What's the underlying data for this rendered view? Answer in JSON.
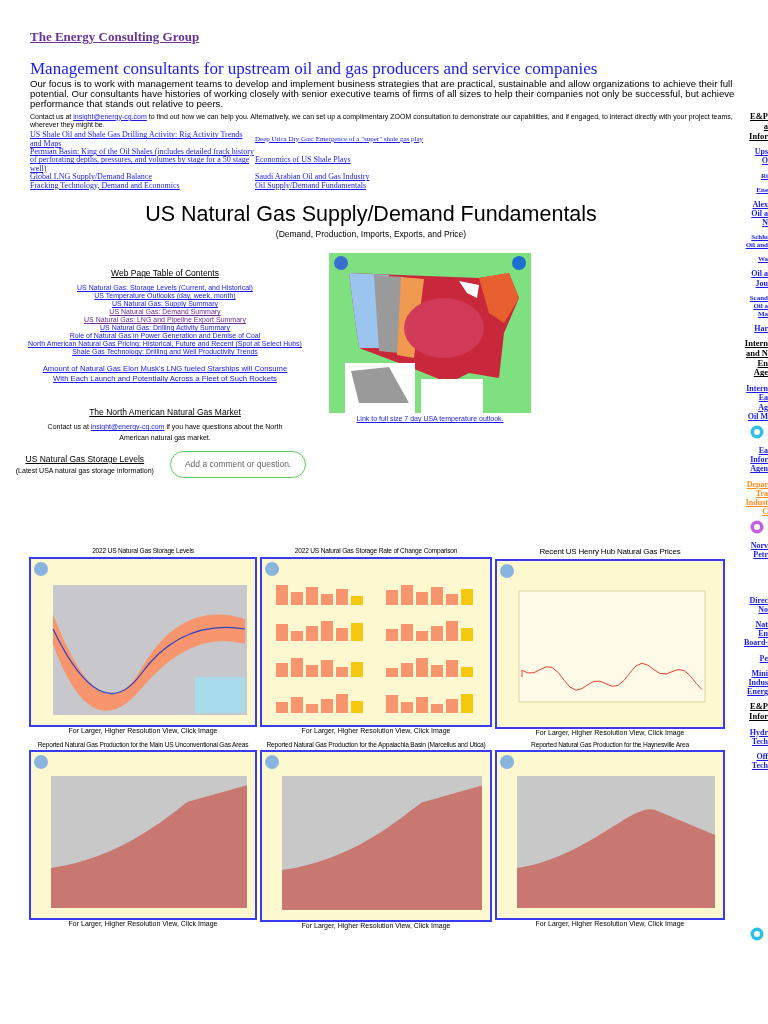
{
  "site_title": "The Energy Consulting Group",
  "tagline": "Management consultants for upstream oil and gas producers and service companies",
  "intro": "Our focus is to work with management teams to develop and implement business strategies that are practical, sustainable and allow organizations to achieve their full potential. Our consultants have histories of working closely with senior executive teams of firms of all sizes to help their companies not only be successful, but achieve performance that stands out relative to peers.",
  "contact": {
    "before": "Contact us at ",
    "link": "insight@energy-cg.com",
    "after": " to find out how we can help you.  Alternatively, we can set up a complimentary ZOOM consultation to demonstrate our capabilities, and if engaged, to interact directly with your project teams, wherever they might be."
  },
  "links_left": [
    "US Shale Oil and Shale Gas Drilling Activity: Rig Activity Trends and Maps",
    "Permian Basin:  King of the Oil Shales (includes detailed frack history of perforating depths, pressures, and volumes by stage for a 50 stage well)",
    "Global LNG Supply/Demand Balance",
    "Fracking Technology, Demand and Economics"
  ],
  "links_right": [
    {
      "text": "Deep Utica Dry Gas:  Emergence of a \"super\" shale gas play",
      "kind": "small"
    },
    {
      "text": "Economics of US Shale Plays",
      "kind": "normal"
    },
    {
      "text": "Saudi Arabian Oil and Gas Industry",
      "kind": "normal"
    },
    {
      "text": "Oil Supply/Demand Fundamentals",
      "kind": "normal"
    }
  ],
  "page_title": "US Natural Gas Supply/Demand Fundamentals",
  "page_subtitle": "(Demand, Production, Imports, Exports, and Price)",
  "toc": {
    "title": "Web Page Table of Contents",
    "items": [
      {
        "text": "US Natural Gas: Storage Levels (Current, and Historical)",
        "visited": false
      },
      {
        "text": "US Temperature Outlooks (day, week, month)",
        "visited": false
      },
      {
        "text": "US Natural Gas: Supply Summary",
        "visited": false
      },
      {
        "text": "US Natural Gas: Demand Summary",
        "visited": true
      },
      {
        "text": "US Natural Gas: LNG and Pipeline Export Summary",
        "visited": true
      },
      {
        "text": "US Natural Gas: Drilling Activity Summary",
        "visited": false
      },
      {
        "text": "Role of Natural Gas in Power Generation and Demise of Coal",
        "visited": false
      },
      {
        "text": "North American Natural Gas Pricing: Historical, Future and Recent (Spot at Select Hubs)",
        "visited": false
      },
      {
        "text": "Shale Gas Technology:  Drilling and Well Productivity Trends",
        "visited": false
      }
    ]
  },
  "feature_link": "Amount of Natural Gas Elon Musk's LNG fueled Starships will Consume With Each Launch and Potentially Across a Fleet of Such Rockets",
  "map": {
    "kind": "picture",
    "caption": "Link to full size 7 day USA temperature outlook."
  },
  "market": {
    "title": "The North American Natural Gas Market",
    "before": "Contact us at ",
    "link": "insight@energy-cg.com",
    "after": " if you have questions about the North American natural gas market."
  },
  "storage": {
    "title": "US Natural Gas Storage Levels",
    "subtitle": "(Latest USA natural gas storage information)"
  },
  "comment_button": "Add a comment or question.",
  "charts": [
    {
      "title": "2022 US Natural Gas Storage Levels",
      "caption": "For Larger, Higher Resolution View, Click Image"
    },
    {
      "title": "2022 US Natural Gas Storage Rate of Change Comparison",
      "caption": "For Larger, Higher Resolution View, Click Image"
    },
    {
      "title": "Recent US Henry Hub Natural Gas Prices",
      "caption": "For Larger, Higher Resolution View, Click Image"
    },
    {
      "title": "Reported Natural Gas Production for the Main US Unconventional Gas Areas",
      "caption": "For Larger, Higher Resolution View, Click Image"
    },
    {
      "title": "Reported Natural Gas Production for the Appalachia Basin (Marcellus and Utica)",
      "caption": "For Larger, Higher Resolution View, Click Image"
    },
    {
      "title": "Reported Natural Gas Production for the Haynesville Area",
      "caption": "For Larger, Higher Resolution View, Click Image"
    }
  ],
  "sidebar_top": [
    {
      "lines": [
        "E&P",
        "a",
        "Infor"
      ],
      "kind": "heading"
    },
    {
      "lines": [
        "Ups",
        "O"
      ],
      "kind": "link"
    },
    {
      "lines": [
        "Ri"
      ],
      "kind": "small"
    },
    {
      "lines": [
        "Ene"
      ],
      "kind": "small"
    },
    {
      "lines": [
        "Alex",
        "Oil a",
        "N"
      ],
      "kind": "link"
    },
    {
      "lines": [
        "Schlu",
        "Oil and"
      ],
      "kind": "small"
    },
    {
      "lines": [
        "Wa"
      ],
      "kind": "small"
    },
    {
      "lines": [
        "Oil a",
        "Jou"
      ],
      "kind": "link"
    },
    {
      "lines": [
        "Scand",
        "Oil a",
        "Ma"
      ],
      "kind": "small"
    },
    {
      "lines": [
        "Har"
      ],
      "kind": "link"
    },
    {
      "lines": [
        "Intern",
        "and N",
        "En",
        "Age"
      ],
      "kind": "heading"
    },
    {
      "lines": [
        "Intern",
        "Ea",
        "Ag",
        "Oil M"
      ],
      "kind": "link"
    },
    {
      "lines": [
        "Ea",
        "Infor",
        "Agen"
      ],
      "kind": "link"
    },
    {
      "lines": [
        "Depar",
        "Tra",
        "Indust",
        "C"
      ],
      "kind": "highlight"
    },
    {
      "lines": [
        "Norv",
        "Petr"
      ],
      "kind": "link"
    }
  ],
  "sidebar_bottom": [
    {
      "lines": [
        "Direc",
        "No"
      ],
      "kind": "link"
    },
    {
      "lines": [
        "Nat",
        "En",
        "Board-"
      ],
      "kind": "link"
    },
    {
      "lines": [
        "Pe"
      ],
      "kind": "link"
    },
    {
      "lines": [
        "Mini",
        "Indus",
        "Energ"
      ],
      "kind": "link"
    },
    {
      "lines": [
        "E&P",
        "Infor"
      ],
      "kind": "heading"
    },
    {
      "lines": [
        "Hydr",
        "Tech"
      ],
      "kind": "link"
    },
    {
      "lines": [
        "Off",
        "Tech"
      ],
      "kind": "link"
    }
  ]
}
